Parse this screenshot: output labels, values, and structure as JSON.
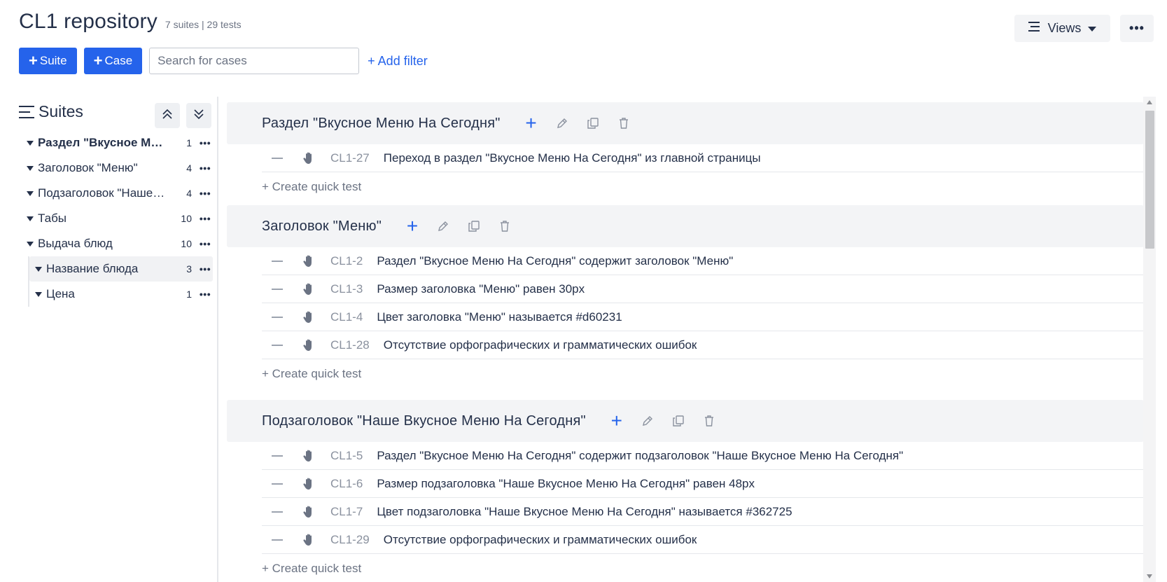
{
  "header": {
    "title": "CL1 repository",
    "meta": "7 suites | 29 tests",
    "views_label": "Views",
    "more_label": "•••"
  },
  "toolbar": {
    "suite_label": "Suite",
    "case_label": "Case",
    "search_placeholder": "Search for cases",
    "add_filter_label": "+ Add filter"
  },
  "sidebar": {
    "title": "Suites",
    "items": [
      {
        "label": "Раздел \"Вкусное Меню На Сегодня\"",
        "count": "1"
      },
      {
        "label": "Заголовок \"Меню\"",
        "count": "4"
      },
      {
        "label": "Подзаголовок \"Наше Вкусное Меню На Сегодня\"",
        "count": "4"
      },
      {
        "label": "Табы",
        "count": "10"
      },
      {
        "label": "Выдача блюд",
        "count": "10"
      },
      {
        "label": "Название блюда",
        "count": "3"
      },
      {
        "label": "Цена",
        "count": "1"
      }
    ],
    "dots": "•••"
  },
  "suites": [
    {
      "title": "Раздел \"Вкусное Меню На Сегодня\"",
      "cases": [
        {
          "id": "CL1-27",
          "title": "Переход в раздел \"Вкусное Меню На Сегодня\" из главной страницы"
        }
      ],
      "quick": "+ Create quick test"
    },
    {
      "title": "Заголовок \"Меню\"",
      "cases": [
        {
          "id": "CL1-2",
          "title": "Раздел \"Вкусное Меню На Сегодня\" содержит заголовок \"Меню\""
        },
        {
          "id": "CL1-3",
          "title": "Размер заголовка \"Меню\" равен 30px"
        },
        {
          "id": "CL1-4",
          "title": "Цвет заголовка \"Меню\" называется #d60231"
        },
        {
          "id": "CL1-28",
          "title": "Отсутствие орфографических и грамматических ошибок"
        }
      ],
      "quick": "+ Create quick test"
    },
    {
      "title": "Подзаголовок \"Наше Вкусное Меню На Сегодня\"",
      "cases": [
        {
          "id": "CL1-5",
          "title": "Раздел \"Вкусное Меню На Сегодня\" содержит подзаголовок \"Наше Вкусное Меню На Сегодня\""
        },
        {
          "id": "CL1-6",
          "title": "Размер подзаголовка \"Наше Вкусное Меню На Сегодня\" равен 48px"
        },
        {
          "id": "CL1-7",
          "title": "Цвет подзаголовка \"Наше Вкусное Меню На Сегодня\" называется #362725"
        },
        {
          "id": "CL1-29",
          "title": "Отсутствие орфографических и грамматических ошибок"
        }
      ],
      "quick": "+ Create quick test"
    }
  ],
  "colors": {
    "primary": "#2563eb",
    "text": "#243049",
    "muted": "#8a919e"
  },
  "icons": [
    "hamburger-icon",
    "chevron-double-up-icon",
    "chevron-double-down-icon",
    "plus-icon",
    "pencil-icon",
    "copy-icon",
    "trash-icon",
    "hand-icon",
    "caret-down-icon",
    "list-icon"
  ]
}
